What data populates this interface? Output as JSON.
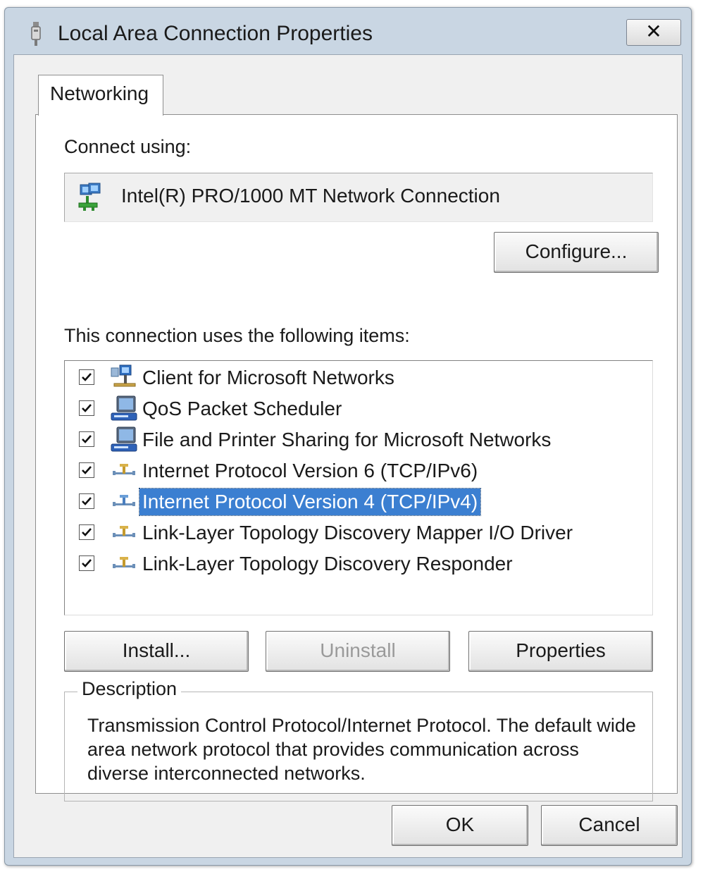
{
  "window": {
    "title": "Local Area Connection Properties",
    "close_label": "✕"
  },
  "tabs": [
    {
      "label": "Networking",
      "selected": true
    }
  ],
  "connect_using": {
    "label": "Connect using:",
    "adapter": "Intel(R) PRO/1000 MT Network Connection",
    "adapter_icon": "network-adapter-icon"
  },
  "configure_label": "Configure...",
  "items_label": "This connection uses the following items:",
  "items": [
    {
      "label": "Client for Microsoft Networks",
      "checked": true,
      "selected": false,
      "icon": "network-client-icon"
    },
    {
      "label": "QoS Packet Scheduler",
      "checked": true,
      "selected": false,
      "icon": "network-service-icon"
    },
    {
      "label": "File and Printer Sharing for Microsoft Networks",
      "checked": true,
      "selected": false,
      "icon": "network-service-icon"
    },
    {
      "label": "Internet Protocol Version 6 (TCP/IPv6)",
      "checked": true,
      "selected": false,
      "icon": "network-protocol-icon"
    },
    {
      "label": "Internet Protocol Version 4 (TCP/IPv4)",
      "checked": true,
      "selected": true,
      "icon": "network-protocol-icon"
    },
    {
      "label": "Link-Layer Topology Discovery Mapper I/O Driver",
      "checked": true,
      "selected": false,
      "icon": "network-protocol-icon"
    },
    {
      "label": "Link-Layer Topology Discovery Responder",
      "checked": true,
      "selected": false,
      "icon": "network-protocol-icon"
    }
  ],
  "buttons": {
    "install": "Install...",
    "uninstall": "Uninstall",
    "properties": "Properties",
    "ok": "OK",
    "cancel": "Cancel"
  },
  "description": {
    "legend": "Description",
    "text": "Transmission Control Protocol/Internet Protocol. The default wide area network protocol that provides communication across diverse interconnected networks."
  },
  "colors": {
    "titlebar": "#c9d6e3",
    "selection": "#3b7fd1"
  }
}
